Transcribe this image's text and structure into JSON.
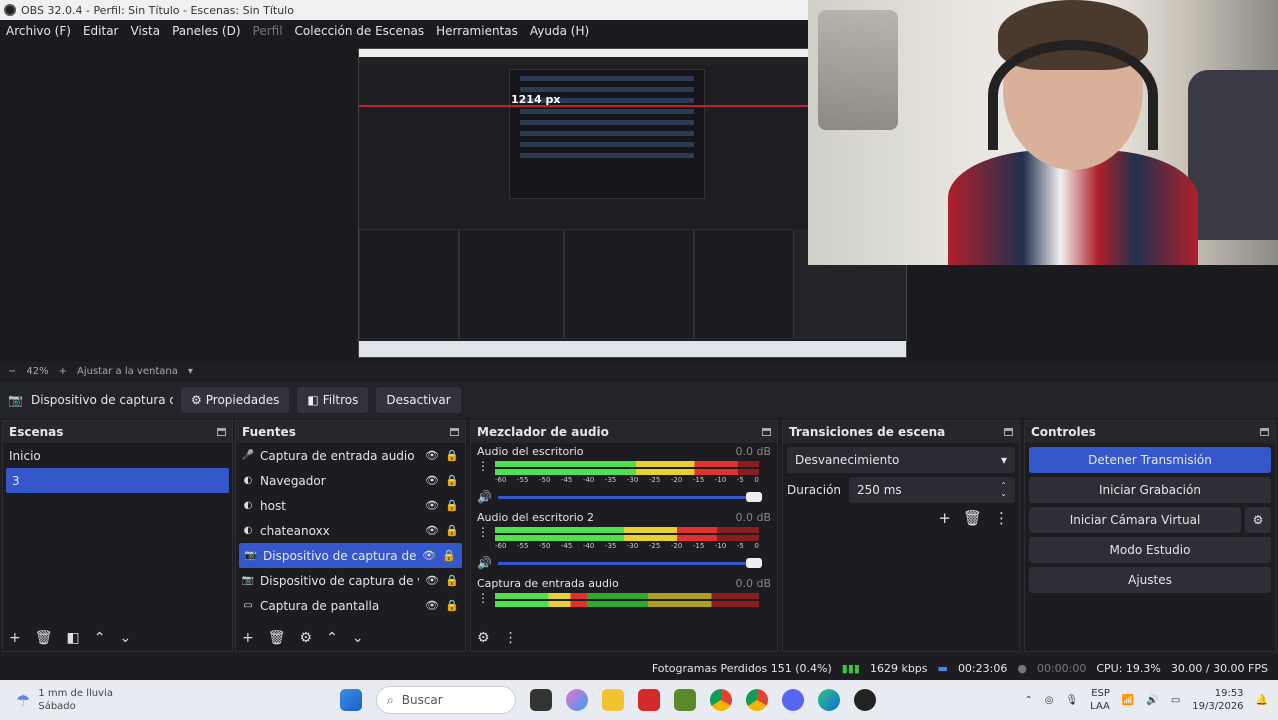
{
  "window": {
    "title": "OBS 32.0.4 - Perfil: Sin Título - Escenas: Sin Título"
  },
  "menu": [
    "Archivo (F)",
    "Editar",
    "Vista",
    "Paneles (D)",
    "Perfil",
    "Colección de Escenas",
    "Herramientas",
    "Ayuda (H)"
  ],
  "preview": {
    "nested_px_label": "1214 px",
    "zoom": "42%",
    "zoom_minus": "−",
    "zoom_plus": "+",
    "fit_label": "Ajustar a la ventana"
  },
  "source_toolbar": {
    "source_name": "Dispositivo de captura de v",
    "properties": "Propiedades",
    "filters": "Filtros",
    "deactivate": "Desactivar"
  },
  "scenes": {
    "title": "Escenas",
    "items": [
      "Inicio",
      "3"
    ],
    "selected": "3"
  },
  "sources": {
    "title": "Fuentes",
    "items": [
      {
        "label": "Captura de entrada audio",
        "icon": "microphone-icon"
      },
      {
        "label": "Navegador",
        "icon": "globe-icon"
      },
      {
        "label": "host",
        "icon": "globe-icon"
      },
      {
        "label": "chateanoxx",
        "icon": "globe-icon"
      },
      {
        "label": "Dispositivo de captura de vídeo",
        "icon": "camera-icon",
        "selected": true
      },
      {
        "label": "Dispositivo de captura de vídeo",
        "icon": "camera-icon"
      },
      {
        "label": "Captura de pantalla",
        "icon": "monitor-icon"
      }
    ]
  },
  "mixer": {
    "title": "Mezclador de audio",
    "ticks": [
      "-60",
      "-55",
      "-50",
      "-45",
      "-40",
      "-35",
      "-30",
      "-25",
      "-20",
      "-15",
      "-10",
      "-5",
      "0"
    ],
    "channels": [
      {
        "name": "Audio del escritorio",
        "db": "0.0 dB",
        "level": 0.92,
        "volume": 1.0
      },
      {
        "name": "Audio del escritorio 2",
        "db": "0.0 dB",
        "level": 0.84,
        "volume": 1.0
      },
      {
        "name": "Captura de entrada audio",
        "db": "0.0 dB",
        "level": 0.35,
        "volume": 1.0
      }
    ]
  },
  "transitions": {
    "title": "Transiciones de escena",
    "selected": "Desvanecimiento",
    "duration_label": "Duración",
    "duration_value": "250 ms"
  },
  "controls": {
    "title": "Controles",
    "stop_stream": "Detener Transmisión",
    "start_recording": "Iniciar Grabación",
    "start_virtual_cam": "Iniciar Cámara Virtual",
    "studio_mode": "Modo Estudio",
    "settings": "Ajustes"
  },
  "status": {
    "dropped_frames": "Fotogramas Perdidos 151 (0.4%)",
    "bitrate": "1629 kbps",
    "stream_time": "00:23:06",
    "record_time": "00:00:00",
    "cpu": "CPU: 19.3%",
    "fps": "30.00 / 30.00 FPS"
  },
  "taskbar": {
    "weather_line1": "1 mm de lluvia",
    "weather_line2": "Sábado",
    "search_placeholder": "Buscar",
    "lang1": "ESP",
    "lang2": "LAA",
    "time": "19:53",
    "date": "19/3/2026"
  },
  "colors": {
    "accent": "#3557c9",
    "dock_bg": "#1c1c21",
    "status_green": "#3cc23c"
  }
}
